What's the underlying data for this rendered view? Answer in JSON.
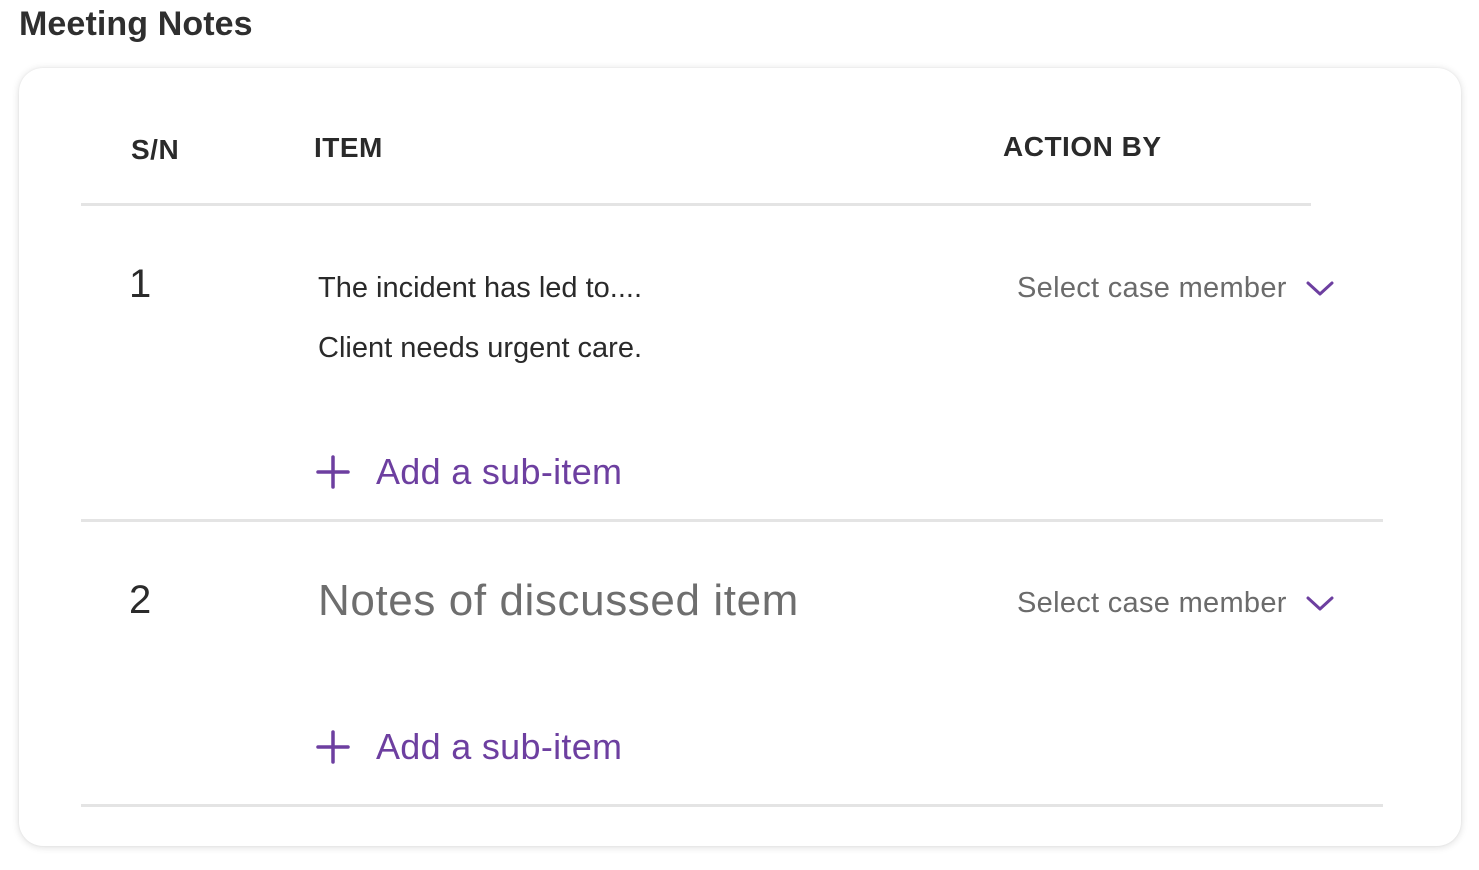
{
  "page": {
    "title": "Meeting Notes"
  },
  "table": {
    "headers": {
      "sn": "S/N",
      "item": "ITEM",
      "action_by": "ACTION BY"
    },
    "rows": [
      {
        "sn": "1",
        "notes": [
          "The incident has led to....",
          "Client needs urgent care."
        ],
        "action_by_placeholder": "Select case member",
        "add_sub_item_label": "Add a sub-item"
      },
      {
        "sn": "2",
        "item_placeholder": "Notes of discussed item",
        "action_by_placeholder": "Select case member",
        "add_sub_item_label": "Add a sub-item"
      }
    ]
  },
  "icons": {
    "plus": "plus-icon",
    "dropdown": "chevron-down-icon"
  },
  "colors": {
    "accent": "#6d3fa0",
    "divider": "#e4e4e4",
    "muted_text": "#6b6b6b"
  }
}
